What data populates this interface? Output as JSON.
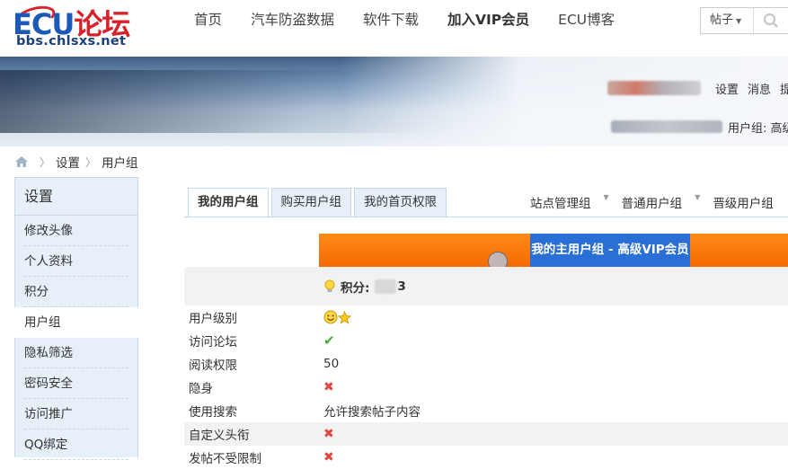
{
  "header": {
    "logo_text": "ECU论坛",
    "logo_domain": "bbs.chlsxs.net",
    "nav": [
      "首页",
      "汽车防盗数据",
      "软件下载",
      "加入VIP会员",
      "ECU博客"
    ],
    "search_type": "帖子"
  },
  "banner": {
    "links": [
      "设置",
      "消息",
      "提"
    ],
    "usergroup_label": "用户组: 高级"
  },
  "breadcrumb": [
    "设置",
    "用户组"
  ],
  "sidebar": {
    "title": "设置",
    "items": [
      "修改头像",
      "个人资料",
      "积分",
      "用户组",
      "隐私筛选",
      "密码安全",
      "访问推广",
      "QQ绑定"
    ],
    "active": "用户组"
  },
  "tabs": [
    "我的用户组",
    "购买用户组",
    "我的首页权限"
  ],
  "group_links": [
    "站点管理组",
    "普通用户组",
    "晋级用户组"
  ],
  "main_group_title": "我的主用户组 - 高级VIP会员",
  "score": {
    "label": "积分:",
    "value_tail": "3"
  },
  "permissions": [
    {
      "key": "用户级别",
      "value": "",
      "icon": "smiley-star-icon"
    },
    {
      "key": "访问论坛",
      "value": "",
      "icon": "check-icon"
    },
    {
      "key": "阅读权限",
      "value": "50",
      "icon": ""
    },
    {
      "key": "隐身",
      "value": "",
      "icon": "cross-icon"
    },
    {
      "key": "使用搜索",
      "value": "允许搜索帖子内容",
      "icon": ""
    },
    {
      "key": "自定义头衔",
      "value": "",
      "icon": "cross-icon"
    },
    {
      "key": "发帖不受限制",
      "value": "",
      "icon": "cross-icon"
    }
  ],
  "colors": {
    "accent_blue": "#2a6fd6",
    "orange_bar": "#f47800",
    "sidebar_bg": "#e7f0f8"
  }
}
